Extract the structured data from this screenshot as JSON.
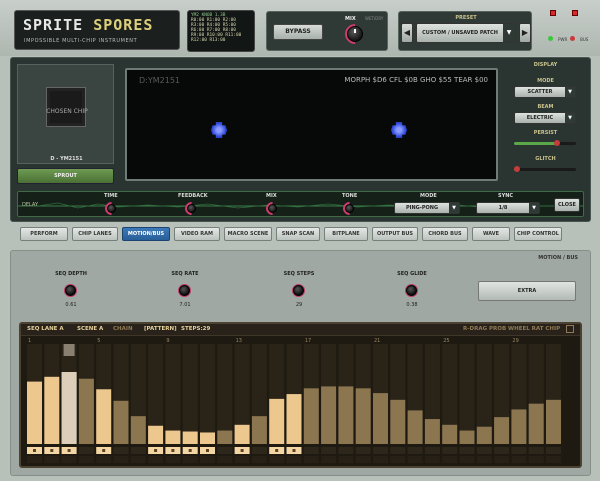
{
  "header": {
    "logo_title_a": "SPRITE",
    "logo_title_b": "SPORES",
    "logo_subtitle": "IMPOSSIBLE MULTI-CHIP INSTRUMENT",
    "registers": [
      "YM2 KNOB 1.3B",
      "R0:00 R1:00 R2:00",
      "R3:00 R4:00 R5:00",
      "R6:00 R7:00 R8:00",
      "R9:00 R10:00 R11:00",
      "R12:00 R13:00"
    ],
    "bypass_label": "BYPASS",
    "mix_label": "MIX",
    "mix_sub": "WET/DRY",
    "preset_label": "PRESET",
    "preset_value": "CUSTOM / UNSAVED PATCH",
    "led_pwr": "PWR",
    "led_bus": "BUS"
  },
  "chip": {
    "chip_art_text": "CHOSEN CHIP",
    "name": "D - YM2151",
    "sprout_label": "SPROUT"
  },
  "scope": {
    "chip_label": "D:YM2151",
    "stats": "MORPH $D6  CFL $0B  GHO $55  TEAR $00"
  },
  "display": {
    "title": "DISPLAY",
    "mode_label": "MODE",
    "mode_value": "SCATTER",
    "beam_label": "BEAM",
    "beam_value": "ELECTRIC",
    "persist_label": "PERSIST",
    "persist_level": 0.7,
    "glitch_label": "GLITCH",
    "glitch_level": 0.05
  },
  "delay": {
    "label": "DELAY",
    "time_label": "TIME",
    "feedback_label": "FEEDBACK",
    "mix_label": "MIX",
    "tone_label": "TONE",
    "mode_label": "MODE",
    "mode_value": "PING-PONG",
    "sync_label": "SYNC",
    "sync_value": "1/8",
    "close_label": "CLOSE"
  },
  "tabs": [
    "PERFORM",
    "CHIP LANES",
    "MOTION/BUS",
    "VIDEO RAM",
    "MACRO SCENE",
    "SNAP SCAN",
    "BITPLANE",
    "OUTPUT BUS",
    "CHORD BUS",
    "WAVE",
    "CHIP CONTROL"
  ],
  "active_tab": "MOTION/BUS",
  "motion": {
    "title": "MOTION / BUS",
    "params": [
      {
        "label": "SEQ DEPTH",
        "value": "0.61"
      },
      {
        "label": "SEQ RATE",
        "value": "7.01"
      },
      {
        "label": "SEQ STEPS",
        "value": "29"
      },
      {
        "label": "SEQ GLIDE",
        "value": "0.38"
      }
    ],
    "extra_label": "EXTRA"
  },
  "sequencer": {
    "lane": "SEQ LANE A",
    "scene": "SCENE A",
    "chain": "CHAIN",
    "pattern": "[PATTERN]",
    "steps_label": "STEPS:29",
    "hint": "R-DRAG PROB  WHEEL RAT  CHIP",
    "markers": [
      "1",
      "5",
      "9",
      "13",
      "17",
      "21",
      "25",
      "29"
    ],
    "values": [
      0.65,
      0.7,
      0.75,
      0.68,
      0.57,
      0.45,
      0.29,
      0.19,
      0.14,
      0.13,
      0.12,
      0.14,
      0.2,
      0.29,
      0.47,
      0.52,
      0.58,
      0.6,
      0.6,
      0.58,
      0.53,
      0.46,
      0.35,
      0.26,
      0.2,
      0.14,
      0.18,
      0.28,
      0.36,
      0.42,
      0.46
    ],
    "accent_steps": [
      1,
      2,
      3,
      5,
      8,
      9,
      10,
      11,
      13,
      15,
      16
    ],
    "colors": {
      "active": "#ecc88e",
      "inactive": "#8c7650",
      "accent": "#f3d6a4",
      "playhead": "#d9cfc0"
    }
  }
}
